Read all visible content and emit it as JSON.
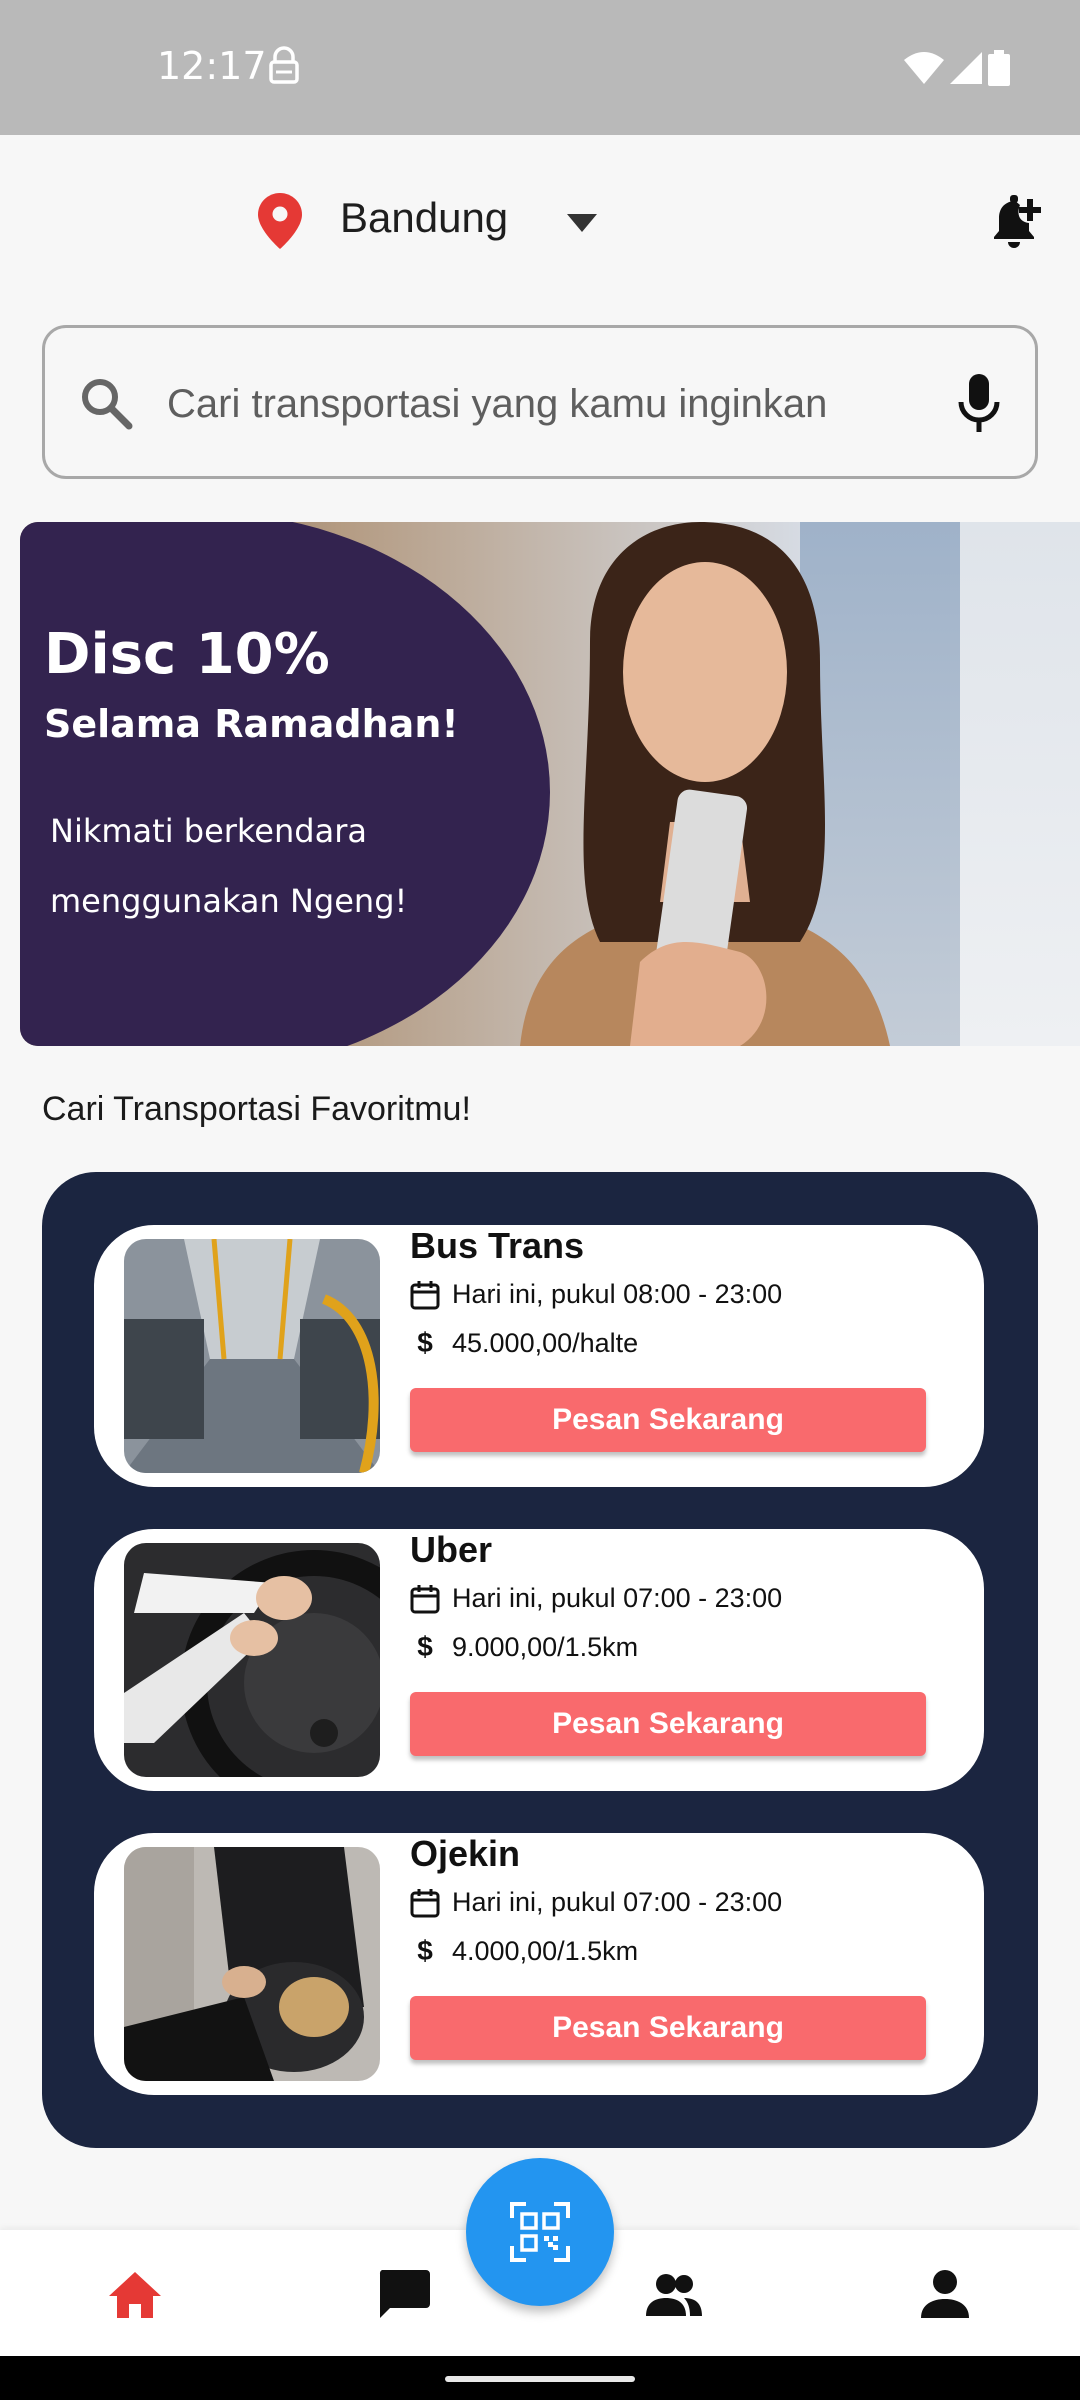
{
  "status_bar": {
    "time": "12:17"
  },
  "header": {
    "location": "Bandung"
  },
  "search": {
    "placeholder": "Cari transportasi yang kamu inginkan"
  },
  "banner": {
    "title": "Disc 10%",
    "subtitle": "Selama Ramadhan!",
    "line1": "Nikmati berkendara",
    "line2": "menggunakan Ngeng!"
  },
  "section_title": "Cari Transportasi Favoritmu!",
  "cards": [
    {
      "name": "Bus Trans",
      "schedule": "Hari ini, pukul 08:00 - 23:00",
      "price": "45.000,00/halte",
      "button": "Pesan Sekarang"
    },
    {
      "name": "Uber",
      "schedule": "Hari ini, pukul 07:00 - 23:00",
      "price": "9.000,00/1.5km",
      "button": "Pesan Sekarang"
    },
    {
      "name": "Ojekin",
      "schedule": "Hari ini, pukul 07:00 - 23:00",
      "price": "4.000,00/1.5km",
      "button": "Pesan Sekarang"
    }
  ],
  "colors": {
    "accent": "#f96a6d",
    "panel": "#1b2540",
    "fab": "#2395f0",
    "nav_active": "#e53935",
    "pin": "#e53935"
  },
  "icons": {
    "nav": [
      "home-icon",
      "chat-icon",
      "people-icon",
      "person-icon"
    ],
    "fab": "qr-scan-icon"
  }
}
